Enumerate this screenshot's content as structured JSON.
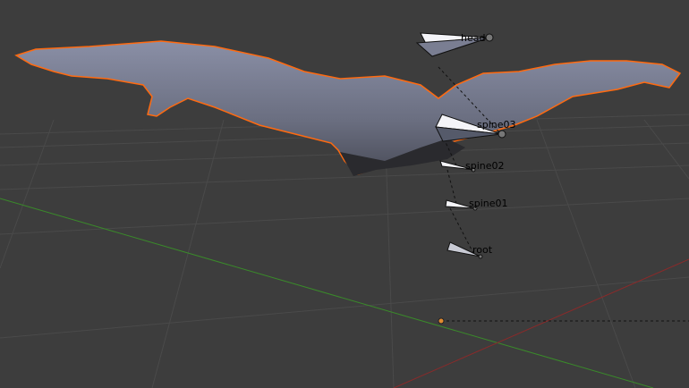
{
  "viewport": {
    "background": "#3d3d3d",
    "selection_outline": "#ff7f1a",
    "x_axis_color": "#8a2a2a",
    "y_axis_color": "#3a8a2a"
  },
  "armature": {
    "bones": [
      {
        "name": "head"
      },
      {
        "name": "spine03"
      },
      {
        "name": "spine02"
      },
      {
        "name": "spine01"
      },
      {
        "name": "root"
      }
    ]
  }
}
